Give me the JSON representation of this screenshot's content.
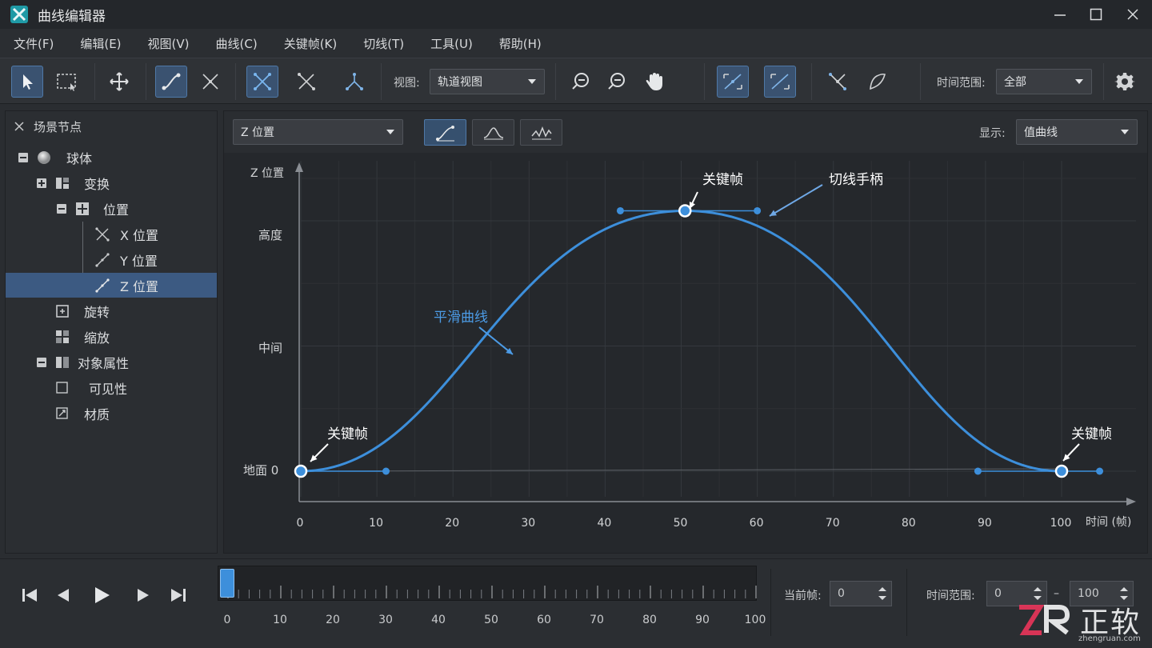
{
  "app": {
    "title": "曲线编辑器"
  },
  "menu": [
    "文件(F)",
    "编辑(E)",
    "视图(V)",
    "曲线(C)",
    "关键帧(K)",
    "切线(T)",
    "工具(U)",
    "帮助(H)"
  ],
  "toolbar": {
    "view_label": "视图:",
    "view_value": "轨道视图",
    "time_range_label": "时间范围:",
    "time_range_value": "全部"
  },
  "scene_panel": {
    "header": "场景节点",
    "items": [
      {
        "label": "球体"
      },
      {
        "label": "变换"
      },
      {
        "label": "位置"
      },
      {
        "label": "X 位置"
      },
      {
        "label": "Y 位置"
      },
      {
        "label": "Z 位置",
        "selected": true
      },
      {
        "label": "旋转"
      },
      {
        "label": "缩放"
      },
      {
        "label": "对象属性"
      },
      {
        "label": "可见性"
      },
      {
        "label": "材质"
      }
    ]
  },
  "graph": {
    "channel": "Z 位置",
    "display_label": "显示:",
    "display_value": "值曲线",
    "annotations": {
      "keyframe": "关键帧",
      "tangent_handle": "切线手柄",
      "smooth_curve": "平滑曲线"
    }
  },
  "chart_data": {
    "type": "line",
    "ylabel": "Z 位置",
    "xlabel": "时间 (帧)",
    "x_ticks": [
      0,
      10,
      20,
      30,
      40,
      50,
      60,
      70,
      80,
      90,
      100
    ],
    "y_ticks": [
      "地面  0",
      "中间",
      "高度"
    ],
    "xlim": [
      0,
      104
    ],
    "grid": true,
    "series": [
      {
        "x": [
          0,
          50.5,
          100
        ],
        "y": [
          0,
          1.04,
          0
        ]
      }
    ],
    "keyframes": [
      {
        "x": 0,
        "y": 0,
        "handle_x": 11.2
      },
      {
        "x": 50.5,
        "y": 1.04,
        "handle_in_x": 42,
        "handle_out_x": 60
      },
      {
        "x": 100,
        "y": 0,
        "handle_in_x": 89,
        "handle_out_x": 105
      }
    ],
    "color": "#3d8fdb"
  },
  "playback": {
    "current_frame_label": "当前帧:",
    "current_frame": "0",
    "range_label": "时间范围:",
    "range_start": "0",
    "range_dash": "–",
    "range_end": "100",
    "timeline_ticks": [
      "0",
      "10",
      "20",
      "30",
      "40",
      "50",
      "60",
      "70",
      "80",
      "90",
      "100"
    ]
  },
  "watermark": {
    "brand": "ZR 正软",
    "site": "zhengruan.com"
  }
}
